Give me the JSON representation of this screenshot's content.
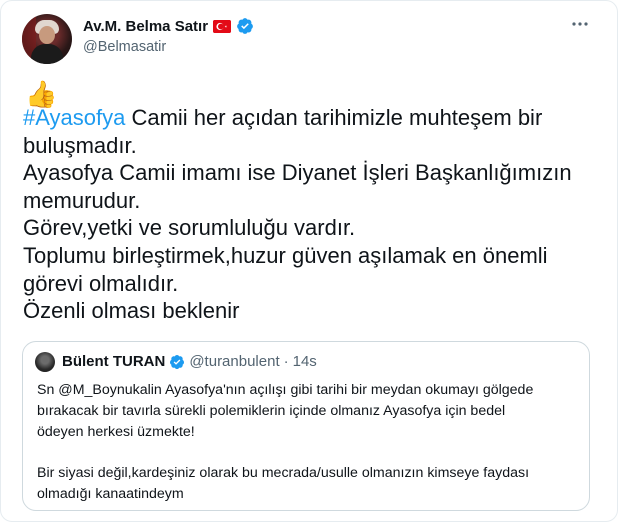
{
  "author": {
    "name": "Av.M. Belma Satır",
    "handle": "@Belmasatir",
    "flag_emoji": "turkey-flag",
    "verified": true
  },
  "tweet": {
    "thumb_emoji": "👍",
    "hashtag": "#Ayasofya",
    "lines": [
      " Camii  her açıdan tarihimizle muhteşem bir",
      "buluşmadır.",
      "Ayasofya Camii imamı ise Diyanet İşleri Başkanlığımızın",
      "memurudur.",
      "Görev,yetki ve sorumluluğu vardır.",
      "Toplumu birleştirmek,huzur güven aşılamak en önemli",
      "görevi olmalıdır.",
      "Özenli olması beklenir"
    ]
  },
  "quoted": {
    "name": "Bülent TURAN",
    "handle": "@turanbulent",
    "separator": "·",
    "time": "14s",
    "verified": true,
    "lines": [
      "Sn @M_Boynukalin Ayasofya'nın açılışı gibi tarihi bir meydan okumayı gölgede",
      "bırakacak bir tavırla sürekli polemiklerin içinde olmanız Ayasofya için bedel",
      "ödeyen herkesi üzmekte!",
      "Bir siyasi değil,kardeşiniz olarak bu mecrada/usulle olmanızın kimseye faydası",
      "olmadığı kanaatindeym"
    ]
  },
  "colors": {
    "link": "#1d9bf0",
    "text": "#0f1419",
    "muted": "#536471",
    "border": "#cfd9de"
  },
  "icons": [
    "more-options-icon",
    "verified-badge-icon",
    "turkey-flag-icon",
    "thumbs-up-emoji"
  ]
}
